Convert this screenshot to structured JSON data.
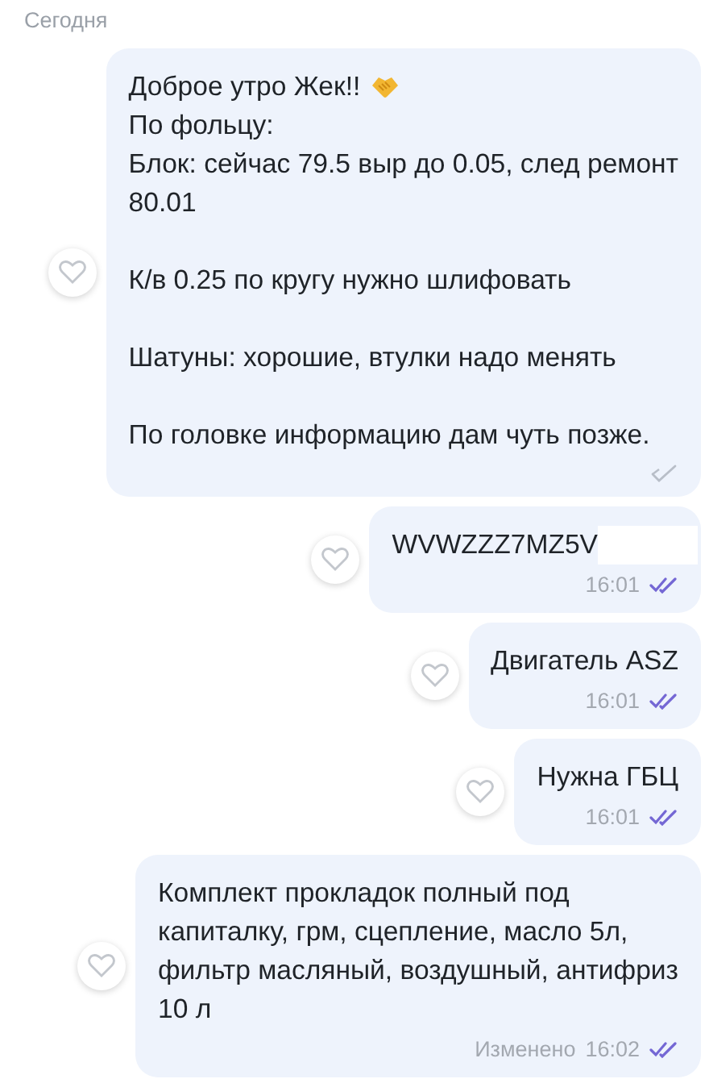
{
  "date_label": "Сегодня",
  "messages": [
    {
      "blocks": [
        [
          {
            "text": "Доброе утро Жек!!",
            "emoji": true
          },
          {
            "text": "По фольцу:"
          },
          {
            "text": "Блок: сейчас 79.5 выр до 0.05, след ремонт\n80.01"
          }
        ],
        [
          {
            "text": "К/в 0.25 по кругу нужно шлифовать"
          }
        ],
        [
          {
            "text": "Шатуны: хорошие, втулки надо менять"
          }
        ],
        [
          {
            "text": "По головке информацию дам чуть позже."
          }
        ]
      ],
      "read": false
    },
    {
      "blocks": [
        [
          {
            "text": "WVWZZZ7MZ5V",
            "redacted": true
          }
        ]
      ],
      "time": "16:01",
      "read": true
    },
    {
      "blocks": [
        [
          {
            "text": "Двигатель ASZ"
          }
        ]
      ],
      "time": "16:01",
      "read": true
    },
    {
      "blocks": [
        [
          {
            "text": "Нужна ГБЦ"
          }
        ]
      ],
      "time": "16:01",
      "read": true
    },
    {
      "blocks": [
        [
          {
            "text": "Комплект прокладок полный под\nкапиталку, грм, сцепление, масло 5л,\nфильтр масляный, воздушный, антифриз\n10 л"
          }
        ]
      ],
      "edited_label": "Изменено",
      "time": "16:02",
      "read": true
    }
  ]
}
